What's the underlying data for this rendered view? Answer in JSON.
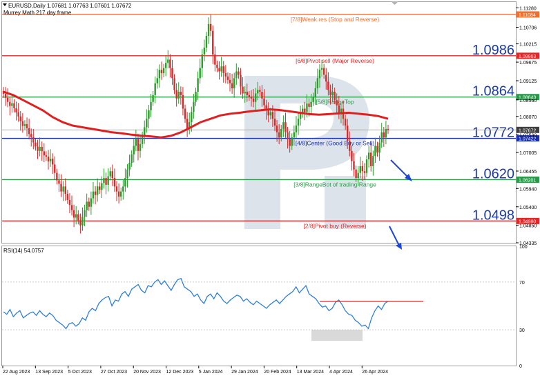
{
  "header": {
    "symbol_line": "EURUSD,Daily  1.07681 1.07763 1.07601 1.07672",
    "indicator_name": "Murrey Math 217 day frame"
  },
  "rsi_label": "RSI(14) 54.0757",
  "colors": {
    "bull": "#2a9d2a",
    "bear": "#d42a2a",
    "ma": "#e02020",
    "rsi": "#2f7fd8",
    "arrow": "#1e46d8",
    "center_line": "#1a2fb0",
    "grid": "#c8c8c8",
    "watermark": "#dde3ea"
  },
  "chart_data": {
    "type": "candlestick",
    "instrument": "EURUSD",
    "timeframe": "Daily",
    "ohlc_last": {
      "open": 1.07681,
      "high": 1.07763,
      "low": 1.07601,
      "close": 1.07672
    },
    "ylim": [
      1.04335,
      1.1145
    ],
    "y_ticks": [
      "1.11280",
      "1.10706",
      "1.10215",
      "1.09675",
      "1.09125",
      "1.08560",
      "1.08070",
      "1.07530",
      "1.07005",
      "1.06455",
      "1.05940",
      "1.05400",
      "1.04850",
      "1.04335"
    ],
    "x_ticks": [
      "22 Aug 2023",
      "13 Sep 2023",
      "5 Oct 2023",
      "27 Oct 2023",
      "20 Nov 2023",
      "12 Dec 2023",
      "5 Jan 2024",
      "29 Jan 2024",
      "20 Feb 2024",
      "13 Mar 2024",
      "4 Apr 2024",
      "26 Apr 2024"
    ],
    "close_series": [
      1.0874,
      1.0862,
      1.085,
      1.0838,
      1.0846,
      1.0831,
      1.0819,
      1.0807,
      1.0793,
      1.0779,
      1.0784,
      1.0772,
      1.0755,
      1.0746,
      1.073,
      1.0718,
      1.0705,
      1.0717,
      1.0704,
      1.0692,
      1.0688,
      1.0674,
      1.0682,
      1.0665,
      1.064,
      1.0618,
      1.0608,
      1.0585,
      1.06,
      1.0578,
      1.056,
      1.0545,
      1.053,
      1.0508,
      1.0518,
      1.05,
      1.0485,
      1.051,
      1.053,
      1.0555,
      1.054,
      1.0565,
      1.0585,
      1.0575,
      1.06,
      1.059,
      1.061,
      1.0625,
      1.0605,
      1.063,
      1.0645,
      1.0625,
      1.06,
      1.0585,
      1.057,
      1.0585,
      1.06,
      1.0625,
      1.065,
      1.067,
      1.0695,
      1.072,
      1.074,
      1.0705,
      1.0725,
      1.075,
      1.0775,
      1.08,
      1.0825,
      1.085,
      1.087,
      1.0905,
      1.092,
      1.0945,
      1.0935,
      1.095,
      1.0965,
      1.0975,
      1.095,
      1.092,
      1.0885,
      1.086,
      1.088,
      1.087,
      1.083,
      1.08,
      1.077,
      1.079,
      1.082,
      1.085,
      1.088,
      1.092,
      1.095,
      1.099,
      1.101,
      1.1045,
      1.108,
      1.106,
      1.099,
      1.096,
      1.095,
      1.094,
      1.0955,
      1.0935,
      1.0925,
      1.0915,
      1.0905,
      1.089,
      1.092,
      1.094,
      1.093,
      1.0895,
      1.0875,
      1.088,
      1.087,
      1.0865,
      1.086,
      1.085,
      1.0875,
      1.0885,
      1.088,
      1.086,
      1.084,
      1.0825,
      1.081,
      1.082,
      1.08,
      1.078,
      1.076,
      1.0745,
      1.077,
      1.079,
      1.076,
      1.074,
      1.072,
      1.0745,
      1.076,
      1.078,
      1.08,
      1.0815,
      1.083,
      1.082,
      1.0845,
      1.0835,
      1.085,
      1.0865,
      1.089,
      1.092,
      1.0945,
      1.095,
      1.093,
      1.091,
      1.0885,
      1.087,
      1.088,
      1.0855,
      1.084,
      1.0815,
      1.083,
      1.08,
      1.078,
      1.0735,
      1.0705,
      1.0675,
      1.065,
      1.0625,
      1.064,
      1.066,
      1.0645,
      1.064,
      1.068,
      1.07,
      1.066,
      1.069,
      1.072,
      1.07,
      1.073,
      1.076,
      1.0745,
      1.077,
      1.0767
    ],
    "ma_series": [
      1.088,
      1.087,
      1.0855,
      1.084,
      1.0825,
      1.0805,
      1.079,
      1.078,
      1.0775,
      1.077,
      1.0765,
      1.076,
      1.0757,
      1.0753,
      1.075,
      1.0748,
      1.0745,
      1.075,
      1.076,
      1.0775,
      1.079,
      1.08,
      1.081,
      1.0815,
      1.0818,
      1.0822,
      1.0825,
      1.0828,
      1.0826,
      1.0822,
      1.0818,
      1.0814,
      1.0812,
      1.0814,
      1.0816,
      1.0818,
      1.0815,
      1.0812,
      1.0808,
      1.08
    ],
    "levels": [
      {
        "label": "[7/8]Weak res (Stop and Reverse)",
        "value": 1.11084,
        "tag": "1.11084",
        "color": "#f07030",
        "big": ""
      },
      {
        "label": "[6/8]Pivot sell (Major Reverse)",
        "value": 1.09863,
        "tag": "1.09863",
        "color": "#e02828",
        "big": "1.0986"
      },
      {
        "label": "[5/8]RangeTop",
        "value": 1.08643,
        "tag": "1.08643",
        "color": "#2a9a4a",
        "big": "1.0864"
      },
      {
        "label": "[4/8]Center (Good Buy or Sell)",
        "value": 1.07422,
        "tag": "1.07422",
        "color": "#1a2fb0",
        "big": "1.0772"
      },
      {
        "label": "[3/8]RangeBot of trading Range",
        "value": 1.06201,
        "tag": "1.06201",
        "color": "#2a9a4a",
        "big": "1.0620"
      },
      {
        "label": "[2/8]Pivot buy (Reverse)",
        "value": 1.0498,
        "tag": "1.04980",
        "color": "#e02828",
        "big": "1.0498"
      }
    ],
    "current_price_tag": "1.07672",
    "rsi": {
      "period": 14,
      "value": 54.0757,
      "ylim": [
        0,
        100
      ],
      "y_ticks": [
        "100",
        "70",
        "30",
        "0"
      ],
      "levels": [
        70,
        30
      ],
      "values": [
        45,
        43,
        47,
        41,
        44,
        46,
        40,
        42,
        44,
        45,
        42,
        46,
        43,
        41,
        44,
        42,
        38,
        36,
        34,
        31,
        35,
        36,
        33,
        35,
        40,
        38,
        45,
        48,
        46,
        52,
        55,
        57,
        58,
        50,
        55,
        54,
        60,
        62,
        58,
        64,
        66,
        68,
        63,
        61,
        67,
        66,
        70,
        72,
        68,
        71,
        67,
        63,
        68,
        72,
        73,
        66,
        64,
        62,
        58,
        60,
        55,
        52,
        58,
        60,
        56,
        61,
        58,
        54,
        52,
        55,
        57,
        59,
        58,
        54,
        56,
        53,
        51,
        54,
        52,
        50,
        48,
        51,
        53,
        55,
        52,
        55,
        58,
        60,
        62,
        66,
        61,
        64,
        67,
        60,
        58,
        56,
        52,
        49,
        50,
        46,
        48,
        53,
        55,
        51,
        46,
        43,
        42,
        38,
        36,
        33,
        34,
        31,
        40,
        46,
        50,
        47,
        52,
        54
      ]
    },
    "annotations": {
      "rsi_resistance_line": 54.5,
      "forecast_price_target": 1.062
    }
  }
}
